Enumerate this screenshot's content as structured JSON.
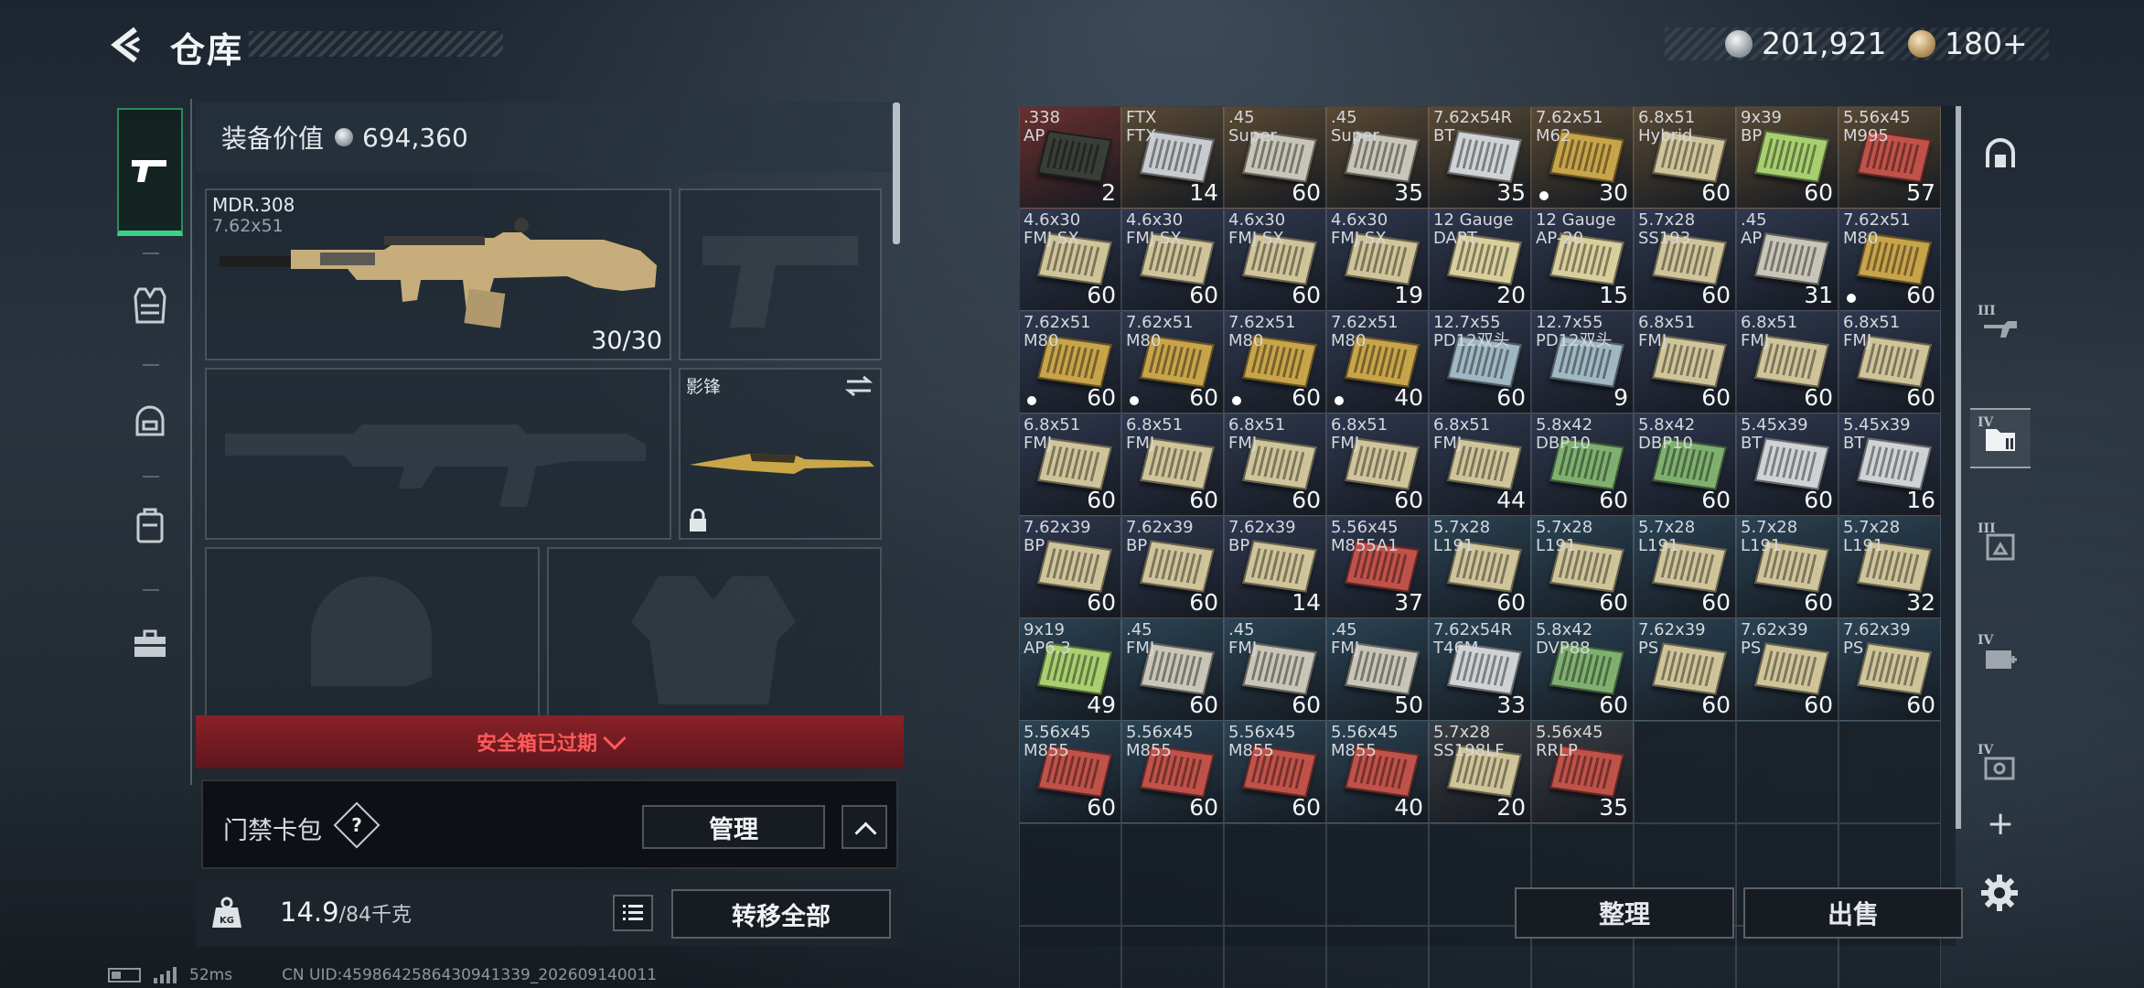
{
  "header": {
    "title": "仓库",
    "currency": {
      "silver": "201,921",
      "gold": "180+"
    }
  },
  "loadout": {
    "equip_value_label": "装备价值",
    "equip_value": "694,360",
    "primary": {
      "name": "MDR.308",
      "caliber": "7.62x51",
      "ammo": "30/30"
    },
    "melee": {
      "name": "影锋"
    },
    "safe_box_status": "安全箱已过期",
    "keycard": {
      "label": "门禁卡包",
      "help": "?",
      "manage": "管理"
    },
    "weight": {
      "current": "14.9",
      "max": "/84千克"
    },
    "transfer_all": "转移全部"
  },
  "storage": {
    "items": [
      {
        "l1": ".338",
        "l2": "AP",
        "count": "2",
        "color": "#3a3e38",
        "bg": "#6b3030"
      },
      {
        "l1": "FTX",
        "l2": "FTX",
        "count": "14",
        "color": "#c8ccd0",
        "bg": "#5a4a34"
      },
      {
        "l1": ".45",
        "l2": "Super",
        "count": "60",
        "color": "#c9c5b8",
        "bg": "#5a4a34"
      },
      {
        "l1": ".45",
        "l2": "Super",
        "count": "35",
        "color": "#c9c5b8",
        "bg": "#5a4a34"
      },
      {
        "l1": "7.62x54R",
        "l2": "BT",
        "count": "35",
        "color": "#d0d3d6",
        "bg": "#5a4a34"
      },
      {
        "l1": "7.62x51",
        "l2": "M62",
        "count": "30",
        "color": "#c8a44a",
        "bg": "#5a4a34",
        "dot": true
      },
      {
        "l1": "6.8x51",
        "l2": "Hybrid",
        "count": "60",
        "color": "#cfc49a",
        "bg": "#5a4a34"
      },
      {
        "l1": "9x39",
        "l2": "BP",
        "count": "60",
        "color": "#a8d070",
        "bg": "#5a4a34"
      },
      {
        "l1": "5.56x45",
        "l2": "M995",
        "count": "57",
        "color": "#c0524a",
        "bg": "#5a4a34"
      },
      {
        "l1": "4.6x30",
        "l2": "FMJ SX",
        "count": "60",
        "color": "#cfc49a",
        "bg": "#2f3850"
      },
      {
        "l1": "4.6x30",
        "l2": "FMJ SX",
        "count": "60",
        "color": "#cfc49a",
        "bg": "#2f3850"
      },
      {
        "l1": "4.6x30",
        "l2": "FMJ SX",
        "count": "60",
        "color": "#cfc49a",
        "bg": "#2f3850"
      },
      {
        "l1": "4.6x30",
        "l2": "FMJ SX",
        "count": "19",
        "color": "#cfc49a",
        "bg": "#2f3850"
      },
      {
        "l1": "12 Gauge",
        "l2": "DART",
        "count": "20",
        "color": "#d8cf9c",
        "bg": "#2f3850"
      },
      {
        "l1": "12 Gauge",
        "l2": "AP-20",
        "count": "15",
        "color": "#d8cf9c",
        "bg": "#2f3850"
      },
      {
        "l1": "5.7x28",
        "l2": "SS193",
        "count": "60",
        "color": "#cfc49a",
        "bg": "#2f3850"
      },
      {
        "l1": ".45",
        "l2": "AP",
        "count": "31",
        "color": "#c9c5b8",
        "bg": "#2f3850"
      },
      {
        "l1": "7.62x51",
        "l2": "M80",
        "count": "60",
        "color": "#c8a44a",
        "bg": "#2f3850",
        "dot": true
      },
      {
        "l1": "7.62x51",
        "l2": "M80",
        "count": "60",
        "color": "#c8a44a",
        "bg": "#2f3850",
        "dot": true
      },
      {
        "l1": "7.62x51",
        "l2": "M80",
        "count": "60",
        "color": "#c8a44a",
        "bg": "#2f3850",
        "dot": true
      },
      {
        "l1": "7.62x51",
        "l2": "M80",
        "count": "60",
        "color": "#c8a44a",
        "bg": "#2f3850",
        "dot": true
      },
      {
        "l1": "7.62x51",
        "l2": "M80",
        "count": "40",
        "color": "#c8a44a",
        "bg": "#2f3850",
        "dot": true
      },
      {
        "l1": "12.7x55",
        "l2": "PD12双头",
        "count": "60",
        "color": "#9fb8c4",
        "bg": "#2f3850"
      },
      {
        "l1": "12.7x55",
        "l2": "PD12双头",
        "count": "9",
        "color": "#9fb8c4",
        "bg": "#2f3850"
      },
      {
        "l1": "6.8x51",
        "l2": "FMJ",
        "count": "60",
        "color": "#cfc49a",
        "bg": "#2f3850"
      },
      {
        "l1": "6.8x51",
        "l2": "FMJ",
        "count": "60",
        "color": "#cfc49a",
        "bg": "#2f3850"
      },
      {
        "l1": "6.8x51",
        "l2": "FMJ",
        "count": "60",
        "color": "#cfc49a",
        "bg": "#2f3850"
      },
      {
        "l1": "6.8x51",
        "l2": "FMJ",
        "count": "60",
        "color": "#cfc49a",
        "bg": "#2f3850"
      },
      {
        "l1": "6.8x51",
        "l2": "FMJ",
        "count": "60",
        "color": "#cfc49a",
        "bg": "#2f3850"
      },
      {
        "l1": "6.8x51",
        "l2": "FMJ",
        "count": "60",
        "color": "#cfc49a",
        "bg": "#2f3850"
      },
      {
        "l1": "6.8x51",
        "l2": "FMJ",
        "count": "60",
        "color": "#cfc49a",
        "bg": "#2f3850"
      },
      {
        "l1": "6.8x51",
        "l2": "FMJ",
        "count": "44",
        "color": "#cfc49a",
        "bg": "#2f3850"
      },
      {
        "l1": "5.8x42",
        "l2": "DBP10",
        "count": "60",
        "color": "#7fb070",
        "bg": "#2f3850"
      },
      {
        "l1": "5.8x42",
        "l2": "DBP10",
        "count": "60",
        "color": "#7fb070",
        "bg": "#2f3850"
      },
      {
        "l1": "5.45x39",
        "l2": "BT",
        "count": "60",
        "color": "#d0d3d6",
        "bg": "#2f3850"
      },
      {
        "l1": "5.45x39",
        "l2": "BT",
        "count": "16",
        "color": "#d0d3d6",
        "bg": "#2f3850"
      },
      {
        "l1": "7.62x39",
        "l2": "BP",
        "count": "60",
        "color": "#cfc49a",
        "bg": "#2f3850"
      },
      {
        "l1": "7.62x39",
        "l2": "BP",
        "count": "60",
        "color": "#cfc49a",
        "bg": "#2f3850"
      },
      {
        "l1": "7.62x39",
        "l2": "BP",
        "count": "14",
        "color": "#cfc49a",
        "bg": "#2f3850"
      },
      {
        "l1": "5.56x45",
        "l2": "M855A1",
        "count": "37",
        "color": "#c0524a",
        "bg": "#2f3850"
      },
      {
        "l1": "5.7x28",
        "l2": "L191",
        "count": "60",
        "color": "#cfc49a",
        "bg": "#2b4456"
      },
      {
        "l1": "5.7x28",
        "l2": "L191",
        "count": "60",
        "color": "#cfc49a",
        "bg": "#2b4456"
      },
      {
        "l1": "5.7x28",
        "l2": "L191",
        "count": "60",
        "color": "#cfc49a",
        "bg": "#2b4456"
      },
      {
        "l1": "5.7x28",
        "l2": "L191",
        "count": "60",
        "color": "#cfc49a",
        "bg": "#2b4456"
      },
      {
        "l1": "5.7x28",
        "l2": "L191",
        "count": "32",
        "color": "#cfc49a",
        "bg": "#2b4456"
      },
      {
        "l1": "9x19",
        "l2": "AP6.3",
        "count": "49",
        "color": "#a8d070",
        "bg": "#2b4456"
      },
      {
        "l1": ".45",
        "l2": "FMJ",
        "count": "60",
        "color": "#c9c5b8",
        "bg": "#2b4456"
      },
      {
        "l1": ".45",
        "l2": "FMJ",
        "count": "60",
        "color": "#c9c5b8",
        "bg": "#2b4456"
      },
      {
        "l1": ".45",
        "l2": "FMJ",
        "count": "50",
        "color": "#c9c5b8",
        "bg": "#2b4456"
      },
      {
        "l1": "7.62x54R",
        "l2": "T46M",
        "count": "33",
        "color": "#d0d3d6",
        "bg": "#2b4456"
      },
      {
        "l1": "5.8x42",
        "l2": "DVP88",
        "count": "60",
        "color": "#7fb070",
        "bg": "#2b4456"
      },
      {
        "l1": "7.62x39",
        "l2": "PS",
        "count": "60",
        "color": "#cfc49a",
        "bg": "#2b4456"
      },
      {
        "l1": "7.62x39",
        "l2": "PS",
        "count": "60",
        "color": "#cfc49a",
        "bg": "#2b4456"
      },
      {
        "l1": "7.62x39",
        "l2": "PS",
        "count": "60",
        "color": "#cfc49a",
        "bg": "#2b4456"
      },
      {
        "l1": "5.56x45",
        "l2": "M855",
        "count": "60",
        "color": "#c0524a",
        "bg": "#2b4456"
      },
      {
        "l1": "5.56x45",
        "l2": "M855",
        "count": "60",
        "color": "#c0524a",
        "bg": "#2b4456"
      },
      {
        "l1": "5.56x45",
        "l2": "M855",
        "count": "60",
        "color": "#c0524a",
        "bg": "#2b4456"
      },
      {
        "l1": "5.56x45",
        "l2": "M855",
        "count": "40",
        "color": "#c0524a",
        "bg": "#2b4456"
      },
      {
        "l1": "5.7x28",
        "l2": "SS198LF",
        "count": "20",
        "color": "#cfc49a",
        "bg": "#3a3e44"
      },
      {
        "l1": "5.56x45",
        "l2": "RRLP",
        "count": "35",
        "color": "#c0524a",
        "bg": "#3a3e44"
      }
    ],
    "empty_cells": 21,
    "sort_label": "整理",
    "sell_label": "出售"
  },
  "side_tabs": [
    {
      "tier": "",
      "icon": "safe-icon"
    },
    {
      "tier": "III",
      "icon": "rifle-icon"
    },
    {
      "tier": "IV",
      "icon": "ammo-folder-icon",
      "active": true
    },
    {
      "tier": "III",
      "icon": "crate-icon"
    },
    {
      "tier": "IV",
      "icon": "medkit-icon"
    },
    {
      "tier": "IV",
      "icon": "tools-icon"
    }
  ],
  "add_tab": "+",
  "status": {
    "ping": "52ms",
    "uid": "CN UID:459864258643094133​9_202609140011"
  }
}
